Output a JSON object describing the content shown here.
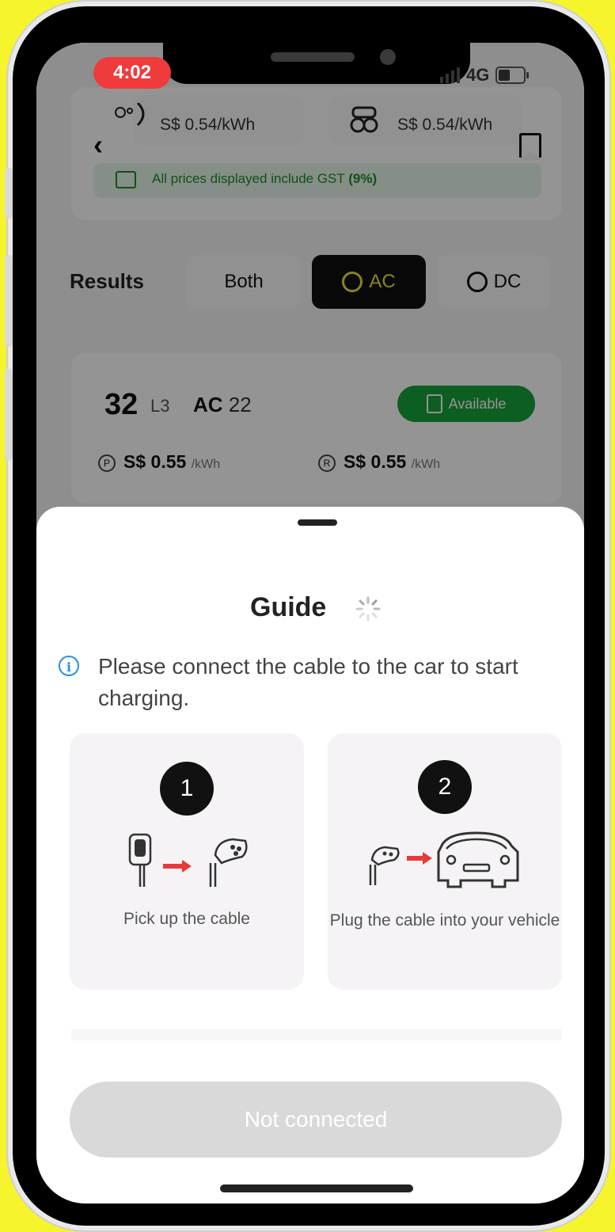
{
  "status_bar": {
    "time": "4:02",
    "network": "4G"
  },
  "prices_header": {
    "price_left": "S$ 0.54/kWh",
    "price_right": "S$ 0.54/kWh",
    "gst_prefix": "All prices displayed include GST",
    "gst_rate": "(9%)"
  },
  "filters": {
    "label": "Results",
    "items": [
      {
        "label": "Both"
      },
      {
        "label": "AC"
      },
      {
        "label": "DC"
      }
    ]
  },
  "result_card": {
    "number": "32",
    "level": "L3",
    "type": "AC",
    "power": "22",
    "status": "Available",
    "price_1": "S$ 0.55",
    "price_2": "S$ 0.55",
    "unit": "/kWh",
    "marker_1": "P",
    "marker_2": "R"
  },
  "guide": {
    "title": "Guide",
    "info": "Please connect the cable to the car to start charging.",
    "steps": [
      {
        "number": "1",
        "caption": "Pick up the cable"
      },
      {
        "number": "2",
        "caption": "Plug the cable into your vehicle"
      }
    ],
    "button_label": "Not connected"
  },
  "colors": {
    "accent_yellow": "#e7e33a",
    "available_green": "#18a33a",
    "info_blue": "#2b8fe0",
    "arrow_red": "#e63b3b",
    "time_pill": "#ef3b3b"
  }
}
